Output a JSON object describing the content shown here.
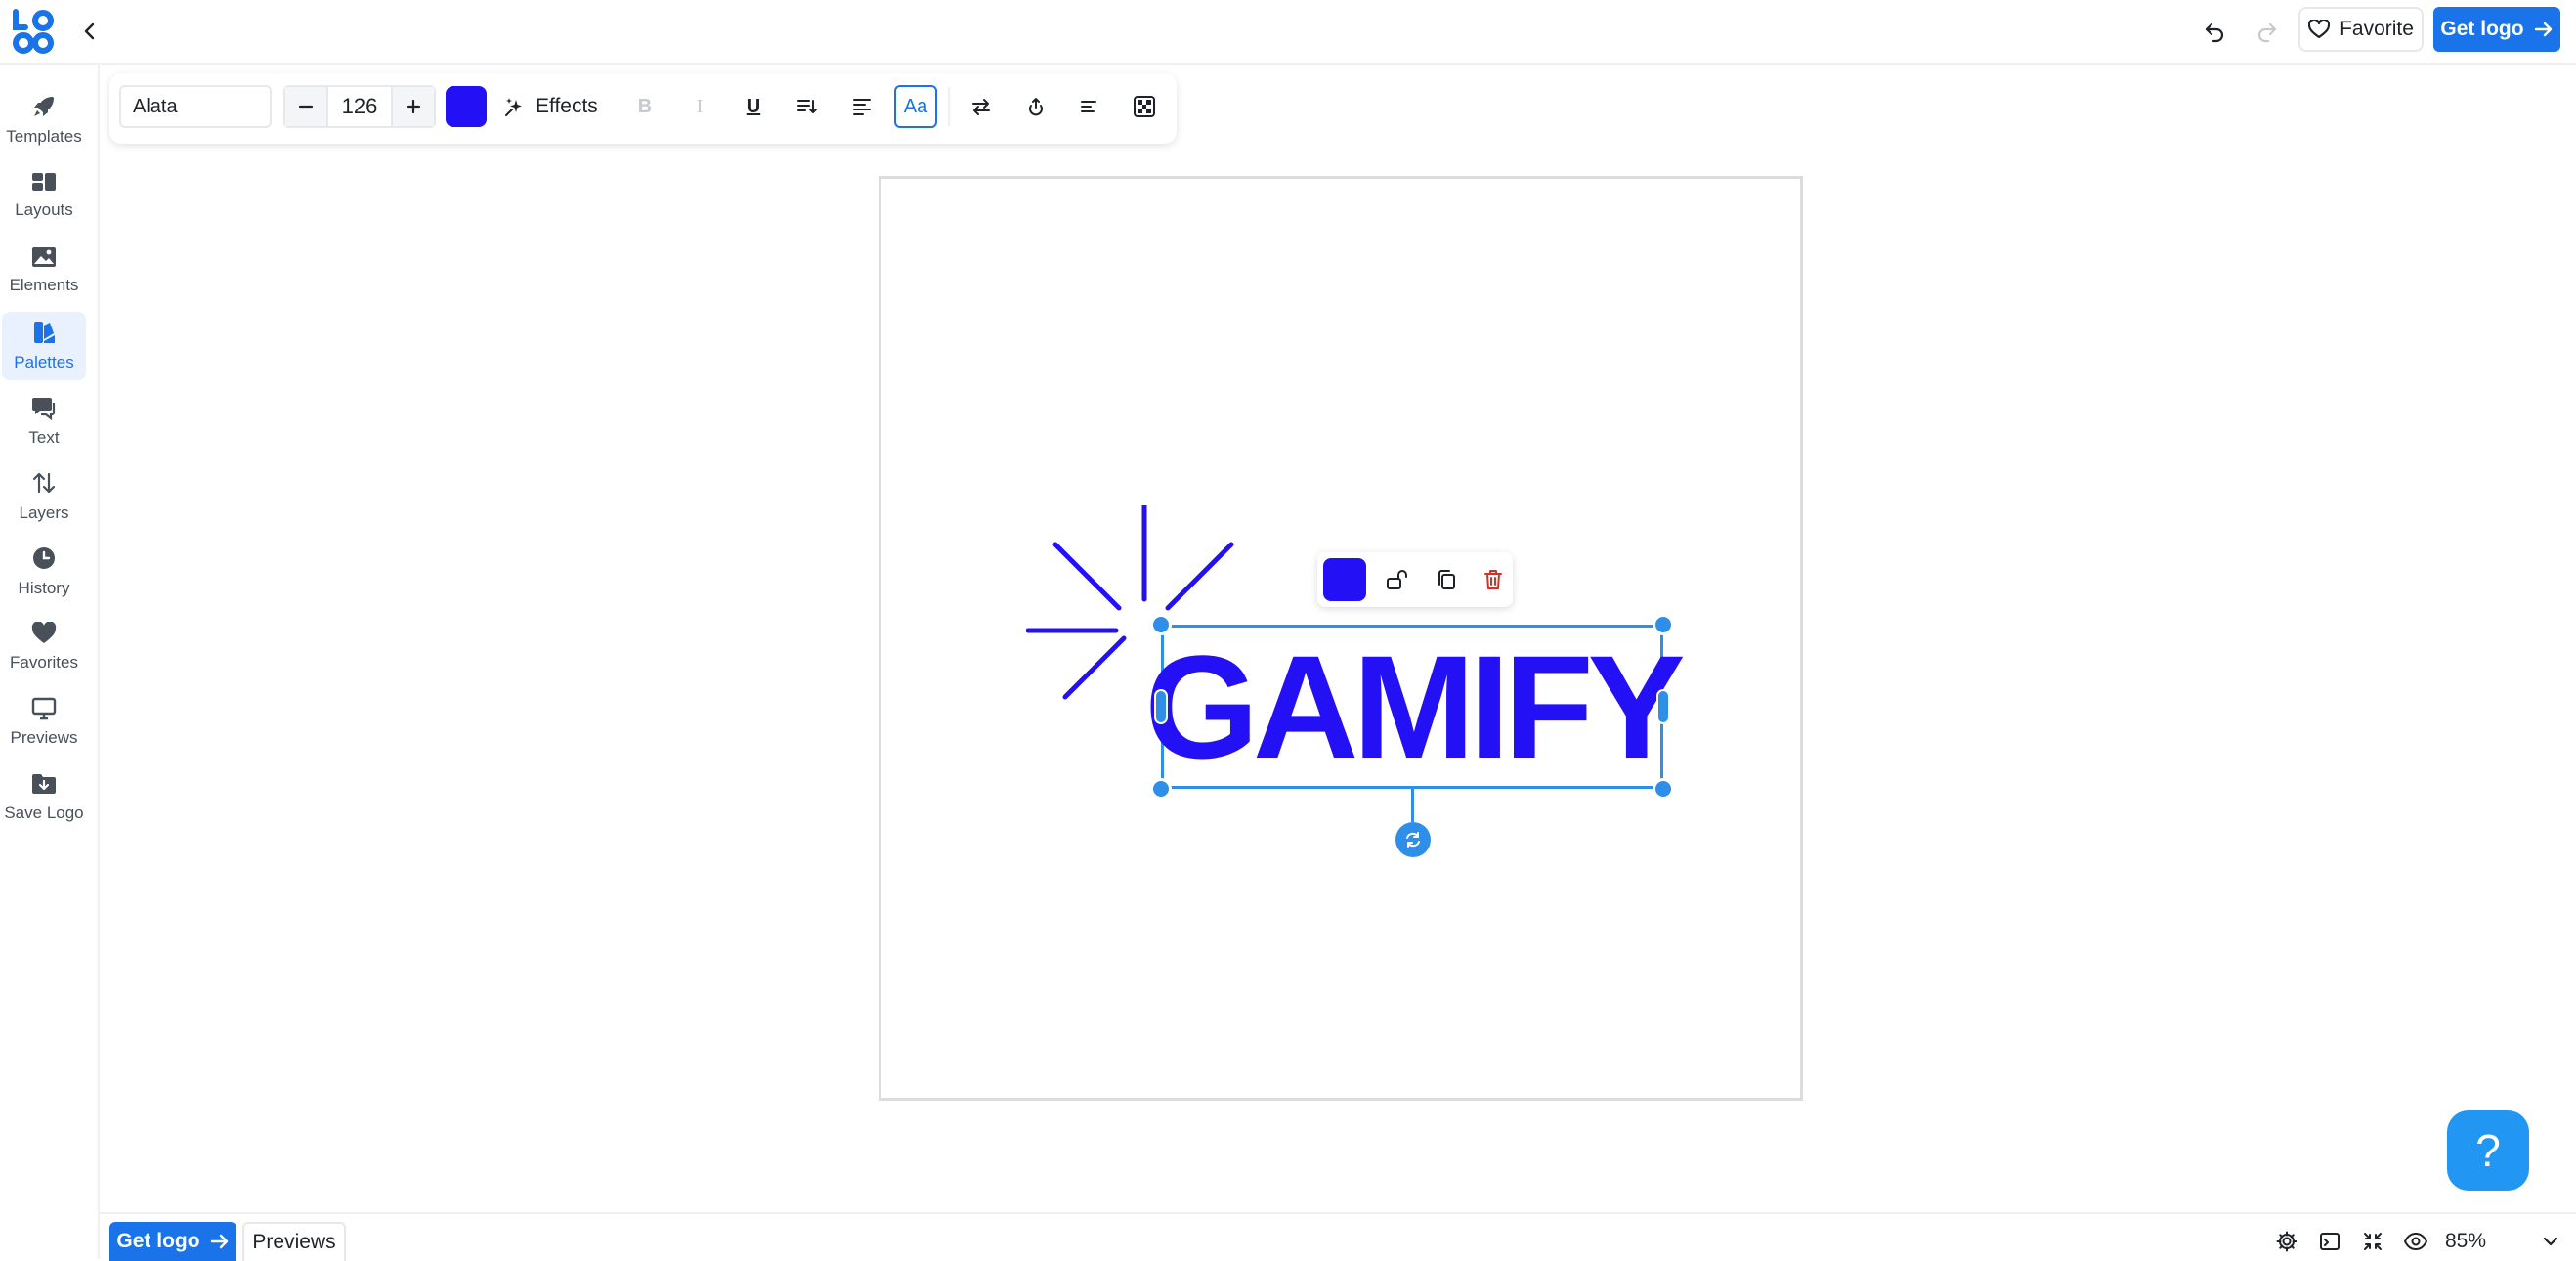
{
  "header": {
    "favorite_label": "Favorite",
    "get_logo_label": "Get logo"
  },
  "sidebar": {
    "items": [
      {
        "label": "Templates",
        "icon": "rocket-icon"
      },
      {
        "label": "Layouts",
        "icon": "layouts-icon"
      },
      {
        "label": "Elements",
        "icon": "image-icon"
      },
      {
        "label": "Palettes",
        "icon": "palette-icon",
        "active": true
      },
      {
        "label": "Text",
        "icon": "text-bubble-icon"
      },
      {
        "label": "Layers",
        "icon": "layers-arrows-icon"
      },
      {
        "label": "History",
        "icon": "clock-icon"
      },
      {
        "label": "Favorites",
        "icon": "heart-icon"
      },
      {
        "label": "Previews",
        "icon": "monitor-icon"
      },
      {
        "label": "Save Logo",
        "icon": "folder-download-icon"
      }
    ]
  },
  "toolbar": {
    "font_name": "Alata",
    "font_size": "126",
    "text_color": "#2410f5",
    "effects_label": "Effects",
    "bold_label": "B",
    "italic_label": "I",
    "underline_label": "U",
    "case_label": "Aa"
  },
  "canvas": {
    "logo_text": "GAMIFY",
    "logo_color": "#2410f5"
  },
  "bottombar": {
    "get_logo_label": "Get logo",
    "previews_label": "Previews",
    "zoom": "85%"
  },
  "help": {
    "label": "?"
  },
  "colors": {
    "accent": "#1a73e8",
    "selection": "#2f8fe8",
    "brand_text": "#2410f5",
    "delete": "#d93025"
  }
}
